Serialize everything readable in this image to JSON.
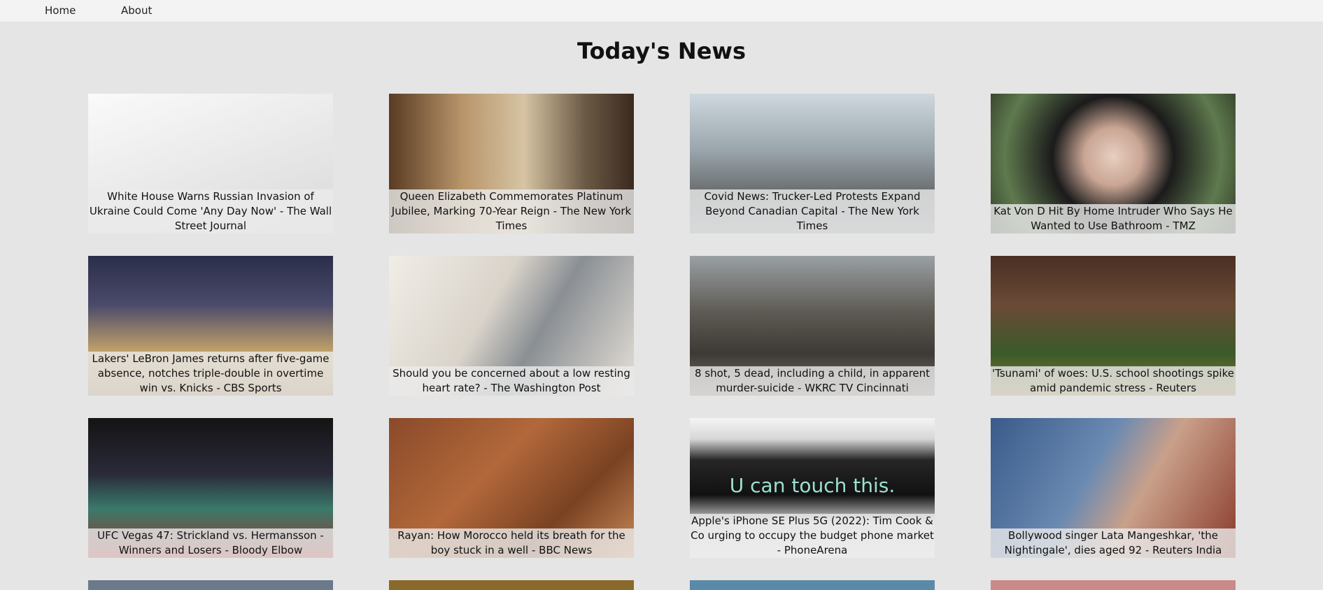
{
  "nav": {
    "home_label": "Home",
    "about_label": "About"
  },
  "page": {
    "title": "Today's News"
  },
  "articles": [
    {
      "caption": "White House Warns Russian Invasion of Ukraine Could Come 'Any Day Now' - The Wall Street Journal"
    },
    {
      "caption": "Queen Elizabeth Commemorates Platinum Jubilee, Marking 70-Year Reign - The New York Times"
    },
    {
      "caption": "Covid News: Trucker-Led Protests Expand Beyond Canadian Capital - The New York Times"
    },
    {
      "caption": "Kat Von D Hit By Home Intruder Who Says He Wanted to Use Bathroom - TMZ"
    },
    {
      "caption": "Lakers' LeBron James returns after five-game absence, notches triple-double in overtime win vs. Knicks - CBS Sports"
    },
    {
      "caption": "Should you be concerned about a low resting heart rate? - The Washington Post"
    },
    {
      "caption": "8 shot, 5 dead, including a child, in apparent murder-suicide - WKRC TV Cincinnati"
    },
    {
      "caption": "'Tsunami' of woes: U.S. school shootings spike amid pandemic stress - Reuters"
    },
    {
      "caption": "UFC Vegas 47: Strickland vs. Hermansson - Winners and Losers - Bloody Elbow"
    },
    {
      "caption": "Rayan: How Morocco held its breath for the boy stuck in a well - BBC News"
    },
    {
      "caption": "Apple's iPhone SE Plus 5G (2022): Tim Cook & Co urging to occupy the budget phone market - PhoneArena"
    },
    {
      "caption": "Bollywood singer Lata Mangeshkar, 'the Nightingale', dies aged 92 - Reuters India"
    }
  ],
  "image_overlay_texts": {
    "iphone": "U can touch this."
  }
}
